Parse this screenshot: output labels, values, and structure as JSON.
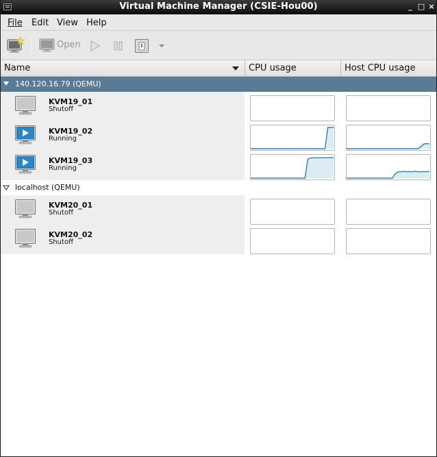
{
  "window": {
    "title": "Virtual Machine Manager (CSIE-Hou00)",
    "controls": [
      "_",
      "□",
      "×"
    ]
  },
  "menu": {
    "file": "File",
    "edit": "Edit",
    "view": "View",
    "help": "Help"
  },
  "toolbar": {
    "new_icon": "new-vm-icon",
    "open_label": "Open",
    "run_icon": "play-icon",
    "pause_icon": "pause-icon",
    "shutdown_icon": "shutdown-icon",
    "menu_icon": "dropdown-arrow-icon"
  },
  "columns": {
    "name": "Name",
    "cpu": "CPU usage",
    "host_cpu": "Host CPU usage"
  },
  "colors": {
    "selected_row": "#5a7b96",
    "graph_line": "#3b7fa3",
    "graph_fill": "#dcebf4"
  },
  "groups": [
    {
      "name": "140.120.16.79 (QEMU)",
      "vms": [
        {
          "name": "KVM19_01",
          "status": "Shutoff",
          "running": false,
          "cpu": [],
          "host_cpu": []
        },
        {
          "name": "KVM19_02",
          "status": "Running",
          "running": true,
          "cpu": [
            0,
            0,
            0,
            0,
            0,
            0,
            0,
            0,
            0,
            0,
            0,
            0,
            0,
            0,
            0,
            0,
            0,
            0,
            0,
            0,
            0,
            0,
            0,
            0,
            0,
            0,
            0,
            1,
            1,
            1
          ],
          "host_cpu": [
            0,
            0,
            0,
            0,
            0,
            0,
            0,
            0,
            0,
            0,
            0,
            0,
            0,
            0,
            0,
            0,
            0,
            0,
            0,
            0,
            0,
            0,
            0,
            0,
            0,
            0,
            0.1,
            0.22,
            0.24,
            0.23
          ]
        },
        {
          "name": "KVM19_03",
          "status": "Running",
          "running": true,
          "cpu": [
            0,
            0,
            0,
            0,
            0,
            0,
            0,
            0,
            0,
            0,
            0,
            0,
            0,
            0,
            0,
            0,
            0,
            0,
            0,
            0,
            0.9,
            0.95,
            0.96,
            0.96,
            0.96,
            0.96,
            0.96,
            0.96,
            0.96,
            0.96
          ],
          "host_cpu": [
            0,
            0,
            0,
            0,
            0,
            0,
            0,
            0,
            0,
            0,
            0,
            0,
            0,
            0,
            0,
            0,
            0,
            0.2,
            0.3,
            0.3,
            0.32,
            0.3,
            0.31,
            0.3,
            0.33,
            0.3,
            0.3,
            0.31,
            0.3,
            0.32
          ]
        }
      ]
    },
    {
      "name": "localhost (QEMU)",
      "vms": [
        {
          "name": "KVM20_01",
          "status": "Shutoff",
          "running": false,
          "cpu": [],
          "host_cpu": []
        },
        {
          "name": "KVM20_02",
          "status": "Shutoff",
          "running": false,
          "cpu": [],
          "host_cpu": []
        }
      ]
    }
  ]
}
